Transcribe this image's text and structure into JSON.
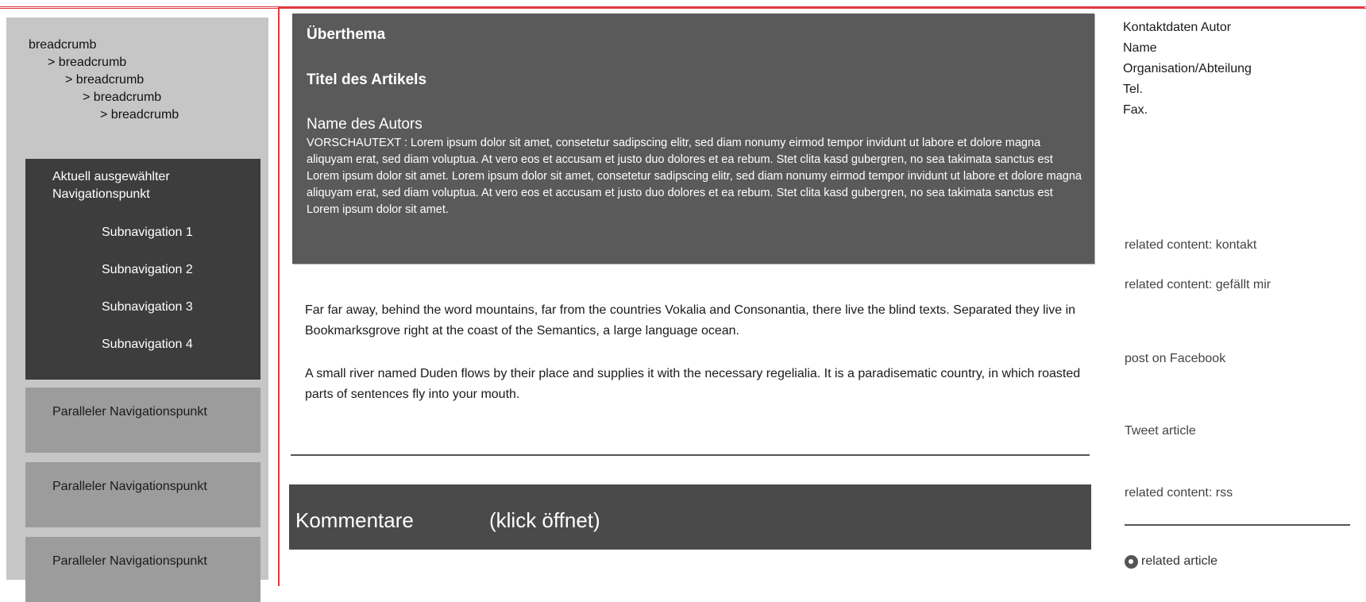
{
  "breadcrumb": [
    "breadcrumb",
    "> breadcrumb",
    "> breadcrumb",
    "> breadcrumb",
    "> breadcrumb"
  ],
  "nav": {
    "active": "Aktuell ausgewählter Navigationspunkt",
    "subitems": [
      "Subnavigation 1",
      "Subnavigation 2",
      "Subnavigation 3",
      "Subnavigation 4"
    ],
    "parallel": [
      "Paralleler Navigationspunkt",
      "Paralleler Navigationspunkt",
      "Paralleler Navigationspunkt"
    ]
  },
  "article": {
    "superhead": "Überthema",
    "title": "Titel des Artikels",
    "author": "Name des Autors",
    "preview": "VORSCHAUTEXT : Lorem ipsum dolor sit amet, consetetur sadipscing elitr, sed diam nonumy eirmod tempor invidunt ut labore et dolore magna aliquyam erat, sed diam voluptua. At vero eos et accusam et justo duo dolores et ea rebum. Stet clita kasd gubergren, no sea takimata sanctus est Lorem ipsum dolor sit amet. Lorem ipsum dolor sit amet, consetetur sadipscing elitr, sed diam nonumy eirmod tempor invidunt ut labore et dolore magna aliquyam erat, sed diam voluptua. At vero eos et accusam et justo duo dolores et ea rebum. Stet clita kasd gubergren, no sea takimata sanctus est Lorem ipsum dolor sit amet.",
    "paragraphs": [
      "Far far away, behind the word mountains, far from the countries Vokalia and Consonantia, there live the blind texts. Separated they live in Bookmarksgrove right at the coast of the Semantics, a large language ocean.",
      "A small river named Duden flows by their place and supplies it with the necessary regelialia. It is a paradisematic country, in which roasted parts of sentences fly into your mouth."
    ]
  },
  "comments": {
    "label": "Kommentare",
    "hint": "(klick öffnet)"
  },
  "contact": {
    "heading": "Kontaktdaten Autor",
    "name": "Name",
    "org": "Organisation/Abteilung",
    "tel": "Tel.",
    "fax": "Fax."
  },
  "related": {
    "kontakt": "related content: kontakt",
    "gefaellt": "related content: gefällt mir",
    "facebook": "post on Facebook",
    "tweet": "Tweet article",
    "rss": "related content: rss",
    "article": "related article"
  },
  "colors": {
    "accent_red": "#e0393e",
    "dark_box": "#3d3d3d",
    "header_box": "#5a5a5a",
    "sidebar": "#c6c6c6"
  }
}
